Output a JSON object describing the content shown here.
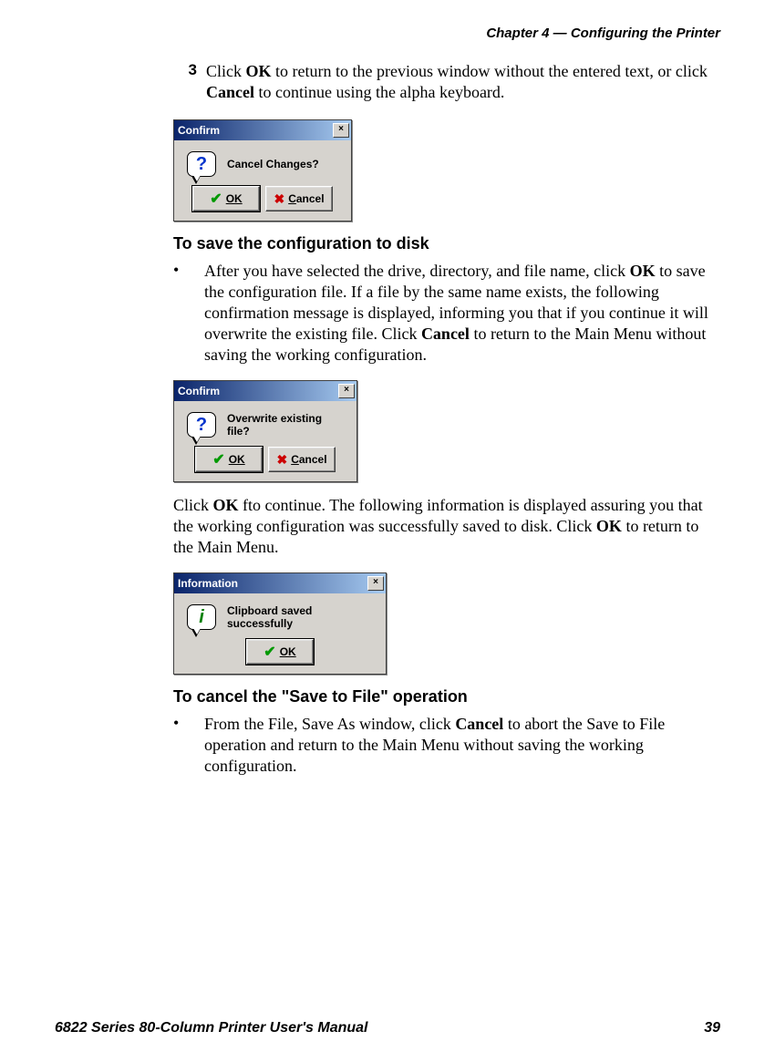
{
  "chapter_header": "Chapter 4 — Configuring the Printer",
  "step3": {
    "num": "3",
    "text_parts": [
      "Click ",
      "OK",
      " to return to the previous window without the entered text, or click ",
      "Cancel",
      " to continue using the alpha keyboard."
    ]
  },
  "dialog1": {
    "title": "Confirm",
    "message": "Cancel Changes?",
    "ok": "OK",
    "cancel": "Cancel"
  },
  "heading_save": "To save the configuration to disk",
  "save_bullet": {
    "parts": [
      "After you have selected the drive, directory, and file name, click ",
      "OK",
      " to save the configuration file. If a file by the same name exists, the following confirmation message is displayed, informing you that if you continue it will overwrite the existing file. Click ",
      "Cancel",
      " to return to the Main Menu without saving the working configuration."
    ]
  },
  "dialog2": {
    "title": "Confirm",
    "message": "Overwrite existing file?",
    "ok": "OK",
    "cancel": "Cancel"
  },
  "para_after_d2": {
    "parts": [
      "Click ",
      "OK",
      " fto continue. The following information is displayed assuring you that the working configuration was successfully saved to disk. Click ",
      "OK",
      " to return to the Main Menu."
    ]
  },
  "dialog3": {
    "title": "Information",
    "message": "Clipboard saved successfully",
    "ok": "OK"
  },
  "heading_cancel": "To cancel the \"Save to File\" operation",
  "cancel_bullet": {
    "parts": [
      "From the File, Save As window, click ",
      "Cancel",
      " to abort the Save to File operation and return to the Main Menu without saving the working configuration."
    ]
  },
  "footer_left": "6822 Series 80-Column Printer User's Manual",
  "footer_right": "39"
}
